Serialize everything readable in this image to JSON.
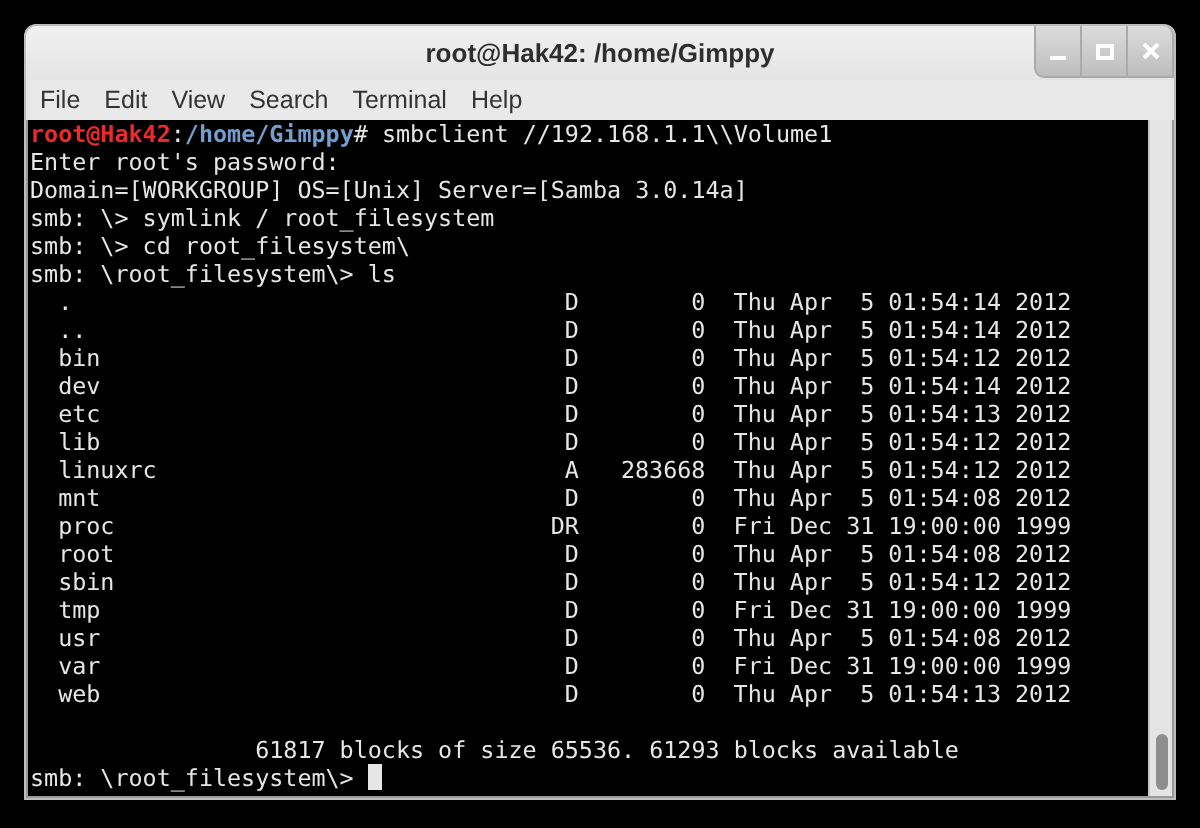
{
  "window": {
    "title": "root@Hak42: /home/Gimppy"
  },
  "menu": [
    "File",
    "Edit",
    "View",
    "Search",
    "Terminal",
    "Help"
  ],
  "terminal": {
    "lines": [
      {
        "kind": "shell_prompt",
        "user_host": "root@Hak42",
        "separator": ":",
        "path": "/home/Gimppy",
        "command": "# smbclient //192.168.1.1\\\\Volume1"
      },
      {
        "kind": "text",
        "text": "Enter root's password:"
      },
      {
        "kind": "text",
        "text": "Domain=[WORKGROUP] OS=[Unix] Server=[Samba 3.0.14a]"
      },
      {
        "kind": "text",
        "text": "smb: \\> symlink / root_filesystem"
      },
      {
        "kind": "text",
        "text": "smb: \\> cd root_filesystem\\"
      },
      {
        "kind": "text",
        "text": "smb: \\root_filesystem\\> ls"
      },
      {
        "kind": "entry",
        "name": ".",
        "attributes": "D",
        "size": "0",
        "modified": "Thu Apr  5 01:54:14 2012"
      },
      {
        "kind": "entry",
        "name": "..",
        "attributes": "D",
        "size": "0",
        "modified": "Thu Apr  5 01:54:14 2012"
      },
      {
        "kind": "entry",
        "name": "bin",
        "attributes": "D",
        "size": "0",
        "modified": "Thu Apr  5 01:54:12 2012"
      },
      {
        "kind": "entry",
        "name": "dev",
        "attributes": "D",
        "size": "0",
        "modified": "Thu Apr  5 01:54:14 2012"
      },
      {
        "kind": "entry",
        "name": "etc",
        "attributes": "D",
        "size": "0",
        "modified": "Thu Apr  5 01:54:13 2012"
      },
      {
        "kind": "entry",
        "name": "lib",
        "attributes": "D",
        "size": "0",
        "modified": "Thu Apr  5 01:54:12 2012"
      },
      {
        "kind": "entry",
        "name": "linuxrc",
        "attributes": "A",
        "size": "283668",
        "modified": "Thu Apr  5 01:54:12 2012"
      },
      {
        "kind": "entry",
        "name": "mnt",
        "attributes": "D",
        "size": "0",
        "modified": "Thu Apr  5 01:54:08 2012"
      },
      {
        "kind": "entry",
        "name": "proc",
        "attributes": "DR",
        "size": "0",
        "modified": "Fri Dec 31 19:00:00 1999"
      },
      {
        "kind": "entry",
        "name": "root",
        "attributes": "D",
        "size": "0",
        "modified": "Thu Apr  5 01:54:08 2012"
      },
      {
        "kind": "entry",
        "name": "sbin",
        "attributes": "D",
        "size": "0",
        "modified": "Thu Apr  5 01:54:12 2012"
      },
      {
        "kind": "entry",
        "name": "tmp",
        "attributes": "D",
        "size": "0",
        "modified": "Fri Dec 31 19:00:00 1999"
      },
      {
        "kind": "entry",
        "name": "usr",
        "attributes": "D",
        "size": "0",
        "modified": "Thu Apr  5 01:54:08 2012"
      },
      {
        "kind": "entry",
        "name": "var",
        "attributes": "D",
        "size": "0",
        "modified": "Fri Dec 31 19:00:00 1999"
      },
      {
        "kind": "entry",
        "name": "web",
        "attributes": "D",
        "size": "0",
        "modified": "Thu Apr  5 01:54:13 2012"
      },
      {
        "kind": "blank"
      },
      {
        "kind": "summary",
        "text": "61817 blocks of size 65536. 61293 blocks available"
      },
      {
        "kind": "input",
        "text": "smb: \\root_filesystem\\>",
        "cursor": true
      }
    ]
  }
}
